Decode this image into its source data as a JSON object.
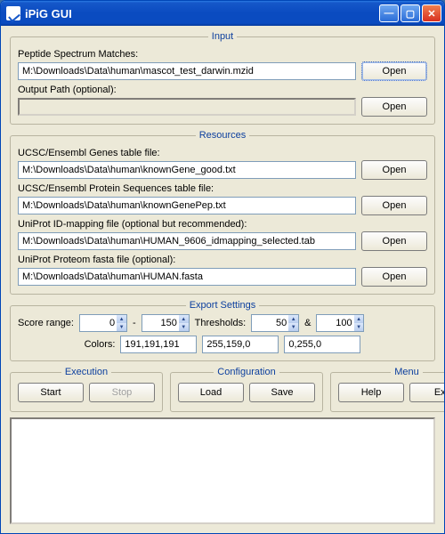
{
  "window": {
    "title": "iPiG GUI"
  },
  "input": {
    "legend": "Input",
    "psm_label": "Peptide Spectrum Matches:",
    "psm_value": "M:\\Downloads\\Data\\human\\mascot_test_darwin.mzid",
    "out_label": "Output Path (optional):",
    "out_value": "",
    "open": "Open"
  },
  "resources": {
    "legend": "Resources",
    "genes_label": "UCSC/Ensembl Genes table file:",
    "genes_value": "M:\\Downloads\\Data\\human\\knownGene_good.txt",
    "prot_label": "UCSC/Ensembl Protein Sequences table file:",
    "prot_value": "M:\\Downloads\\Data\\human\\knownGenePep.txt",
    "idmap_label": "UniProt ID-mapping file  (optional but recommended):",
    "idmap_value": "M:\\Downloads\\Data\\human\\HUMAN_9606_idmapping_selected.tab",
    "fasta_label": "UniProt Proteom fasta file  (optional):",
    "fasta_value": "M:\\Downloads\\Data\\human\\HUMAN.fasta",
    "open": "Open"
  },
  "export": {
    "legend": "Export Settings",
    "score_label": "Score range:",
    "score_min": "0",
    "score_max": "150",
    "dash": "-",
    "thresh_label": "Thresholds:",
    "thresh_a": "50",
    "amp": "&",
    "thresh_b": "100",
    "colors_label": "Colors:",
    "color1": "191,191,191",
    "color2": "255,159,0",
    "color3": "0,255,0"
  },
  "execution": {
    "legend": "Execution",
    "start": "Start",
    "stop": "Stop"
  },
  "config": {
    "legend": "Configuration",
    "load": "Load",
    "save": "Save"
  },
  "menu": {
    "legend": "Menu",
    "help": "Help",
    "exit": "Exit"
  }
}
